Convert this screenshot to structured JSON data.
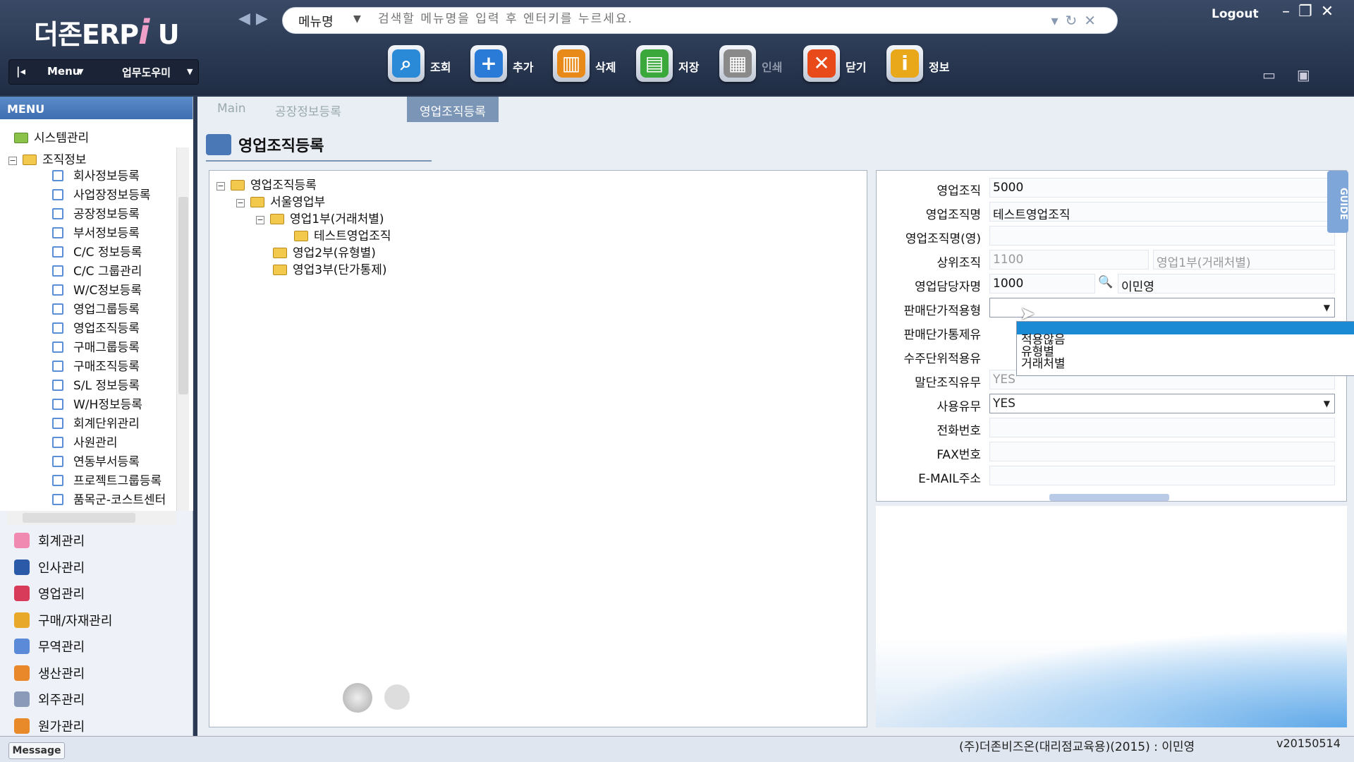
{
  "header": {
    "logo": "더존ERP",
    "logo_i": "i",
    "logo_u": "U",
    "search_select": "메뉴명",
    "search_placeholder": "검색할 메뉴명을 입력 후 엔터키를 누르세요.",
    "logout": "Logout",
    "menu_label": "Menu",
    "helper_label": "업무도우미"
  },
  "toolbar": [
    {
      "label": "조회",
      "icon": "search-icon",
      "color": "#2a8ad8"
    },
    {
      "label": "추가",
      "icon": "plus-icon",
      "color": "#2a7ad8"
    },
    {
      "label": "삭제",
      "icon": "trash-icon",
      "color": "#e88a1a"
    },
    {
      "label": "저장",
      "icon": "save-icon",
      "color": "#3aa83a"
    },
    {
      "label": "인쇄",
      "icon": "print-icon",
      "color": "#8a8a8a"
    },
    {
      "label": "닫기",
      "icon": "close-icon",
      "color": "#e84a1a"
    },
    {
      "label": "정보",
      "icon": "info-icon",
      "color": "#e8a81a"
    }
  ],
  "sidebar": {
    "header": "MENU",
    "top_item": "시스템관리",
    "group": "조직정보",
    "items": [
      "회사정보등록",
      "사업장정보등록",
      "공장정보등록",
      "부서정보등록",
      "C/C 정보등록",
      "C/C 그룹관리",
      "W/C정보등록",
      "영업그룹등록",
      "영업조직등록",
      "구매그룹등록",
      "구매조직등록",
      "S/L 정보등록",
      "W/H정보등록",
      "회계단위관리",
      "사원관리",
      "연동부서등록",
      "프로젝트그룹등록",
      "품목군-코스트센터"
    ],
    "modules": [
      "회계관리",
      "인사관리",
      "영업관리",
      "구매/자재관리",
      "무역관리",
      "생산관리",
      "외주관리",
      "원가관리"
    ]
  },
  "tabs": [
    "Main",
    "공장정보등록",
    "영업조직등록"
  ],
  "page_title": "영업조직등록",
  "tree": {
    "root": "영업조직등록",
    "l1": "서울영업부",
    "l2a": "영업1부(거래처별)",
    "l3": "테스트영업조직",
    "l2b": "영업2부(유형별)",
    "l2c": "영업3부(단가통제)"
  },
  "form": {
    "org_label": "영업조직",
    "org_value": "5000",
    "name_label": "영업조직명",
    "name_value": "테스트영업조직",
    "name_en_label": "영업조직명(영)",
    "parent_label": "상위조직",
    "parent_code": "1100",
    "parent_name": "영업1부(거래처별)",
    "manager_label": "영업담당자명",
    "manager_code": "1000",
    "manager_name": "이민영",
    "price_type_label": "판매단가적용형",
    "price_ctrl_label": "판매단가통제유",
    "order_unit_label": "수주단위적용유",
    "terminal_label": "말단조직유무",
    "terminal_value": "YES",
    "use_label": "사용유무",
    "use_value": "YES",
    "phone_label": "전화번호",
    "fax_label": "FAX번호",
    "email_label": "E-MAIL주소",
    "dropdown_options": [
      "적용않음",
      "유형별",
      "거래처별"
    ]
  },
  "guide": "GUIDE",
  "message_btn": "Message",
  "footer": "(주)더존비즈온(대리점교육용)(2015) : 이민영",
  "version": "v20150514"
}
